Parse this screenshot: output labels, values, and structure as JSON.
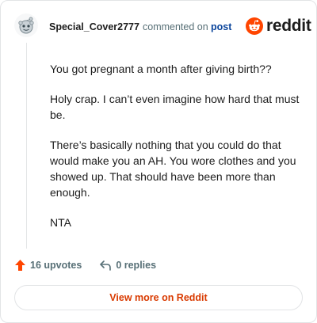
{
  "comment": {
    "username": "Special_Cover2777",
    "commented_on": "commented on",
    "post_link": "post",
    "paragraphs": [
      "You got pregnant a month after giving birth??",
      "Holy crap. I can’t even imagine how hard that must be.",
      "There’s basically nothing that you could do that would make you an AH. You wore clothes and you showed up. That should have been more than enough.",
      "NTA"
    ]
  },
  "brand": {
    "name": "reddit",
    "color": "#ff4500"
  },
  "actions": {
    "upvotes": "16 upvotes",
    "replies": "0 replies"
  },
  "footer": {
    "view_more": "View more on Reddit"
  },
  "colors": {
    "username": "#1c1c1c",
    "meta": "#576f76",
    "post_link": "#0a449b",
    "upvote_arrow": "#ff4500",
    "view_more": "#d93a00"
  },
  "icons": {
    "avatar": "snoo-avatar-icon",
    "logo": "reddit-logo-icon",
    "upvote": "upvote-arrow-icon",
    "reply": "reply-arrow-icon"
  }
}
